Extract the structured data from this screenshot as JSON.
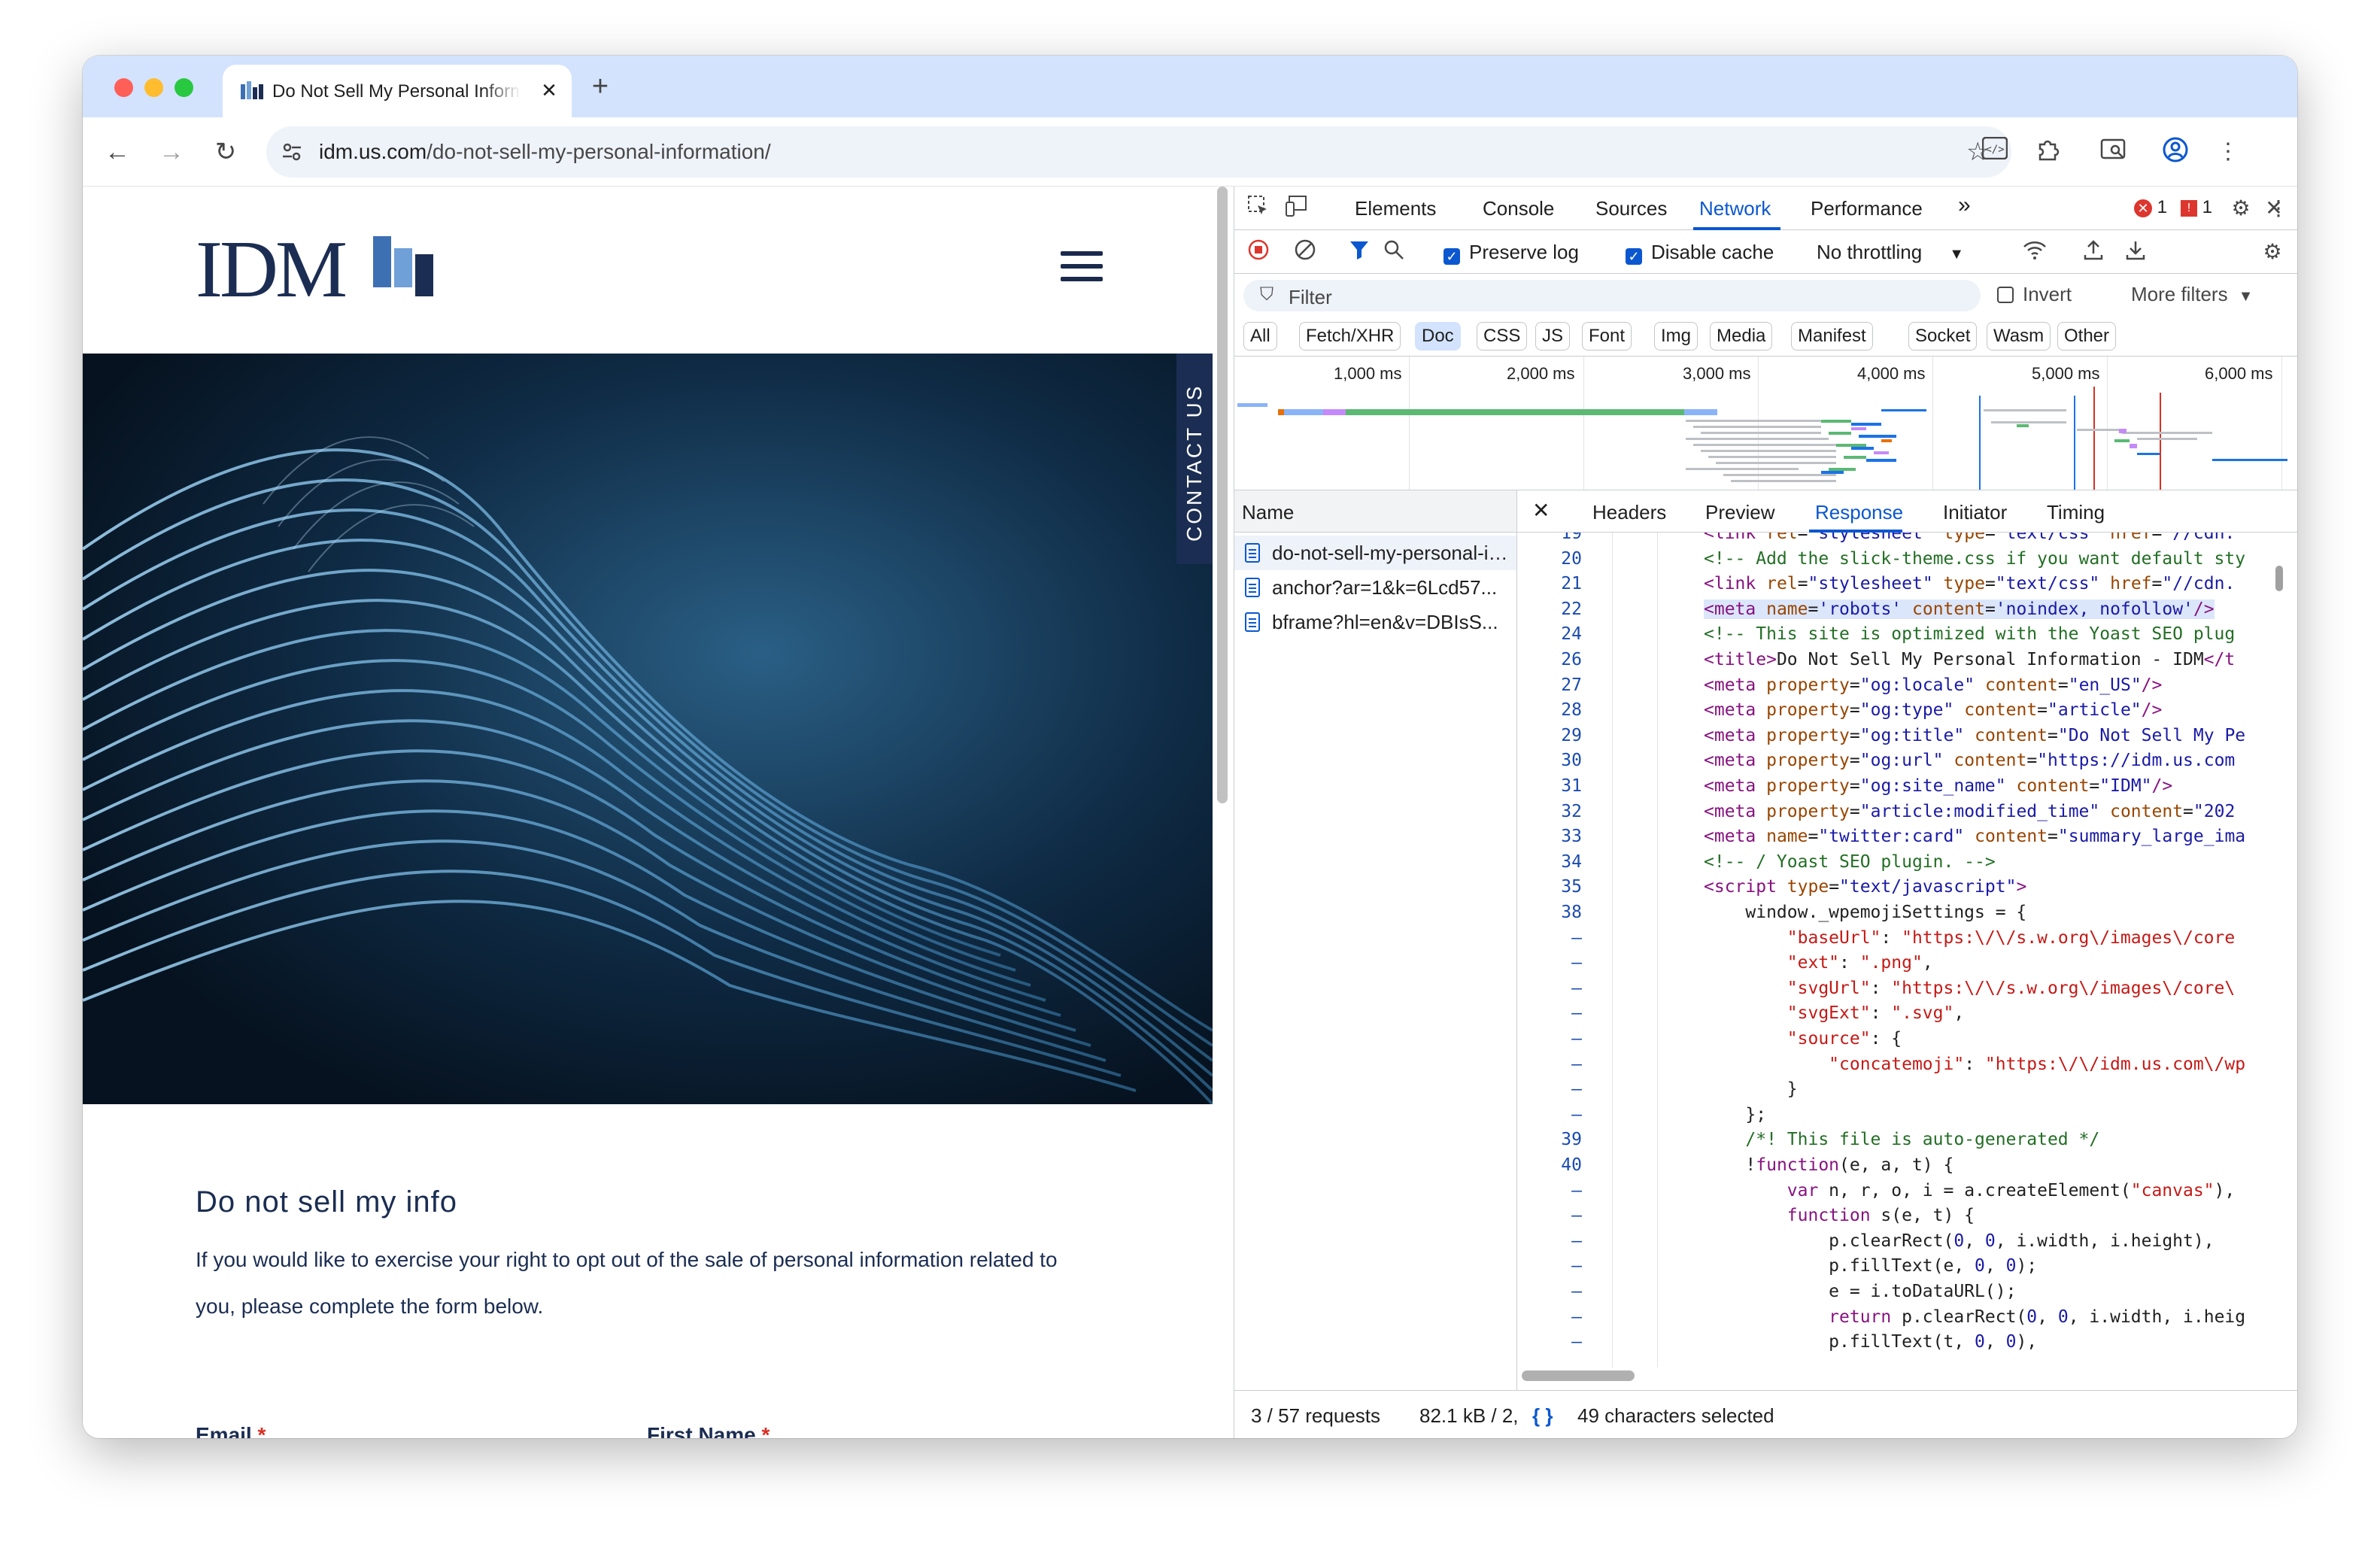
{
  "browser": {
    "tab_title": "Do Not Sell My Personal Information",
    "tab_close": "✕",
    "new_tab": "+",
    "url_host": "idm.us.com",
    "url_path": "/do-not-sell-my-personal-information/"
  },
  "page": {
    "logo_text": "IDM",
    "contact_label": "CONTACT US",
    "heading": "Do not sell my info",
    "paragraph": "If you would like to exercise your right to opt out of the sale of personal information related to you, please complete the form below.",
    "label_email": "Email",
    "label_first_name": "First Name",
    "required_mark": "*"
  },
  "devtools": {
    "tabs": [
      "Elements",
      "Console",
      "Sources",
      "Network",
      "Performance"
    ],
    "more_tabs": "»",
    "error_count": "1",
    "issue_count": "1",
    "toolbar": {
      "preserve_log": "Preserve log",
      "disable_cache": "Disable cache",
      "throttling": "No throttling"
    },
    "filter_placeholder": "Filter",
    "invert_label": "Invert",
    "more_filters": "More filters",
    "type_filters": [
      "All",
      "Fetch/XHR",
      "Doc",
      "CSS",
      "JS",
      "Font",
      "Img",
      "Media",
      "Manifest",
      "Socket",
      "Wasm",
      "Other"
    ],
    "timeline_labels": [
      "1,000 ms",
      "2,000 ms",
      "3,000 ms",
      "4,000 ms",
      "5,000 ms",
      "6,000 ms"
    ],
    "name_header": "Name",
    "requests": [
      "do-not-sell-my-personal-information/",
      "anchor?ar=1&k=6Lcd57...",
      "bframe?hl=en&v=DBIsS..."
    ],
    "detail_tabs": [
      "Headers",
      "Preview",
      "Response",
      "Initiator",
      "Timing"
    ],
    "status": {
      "requests": "3 / 57 requests",
      "transferred": "82.1 kB / 2,",
      "pretty_print": "{ }",
      "selection": "49 characters selected"
    }
  }
}
